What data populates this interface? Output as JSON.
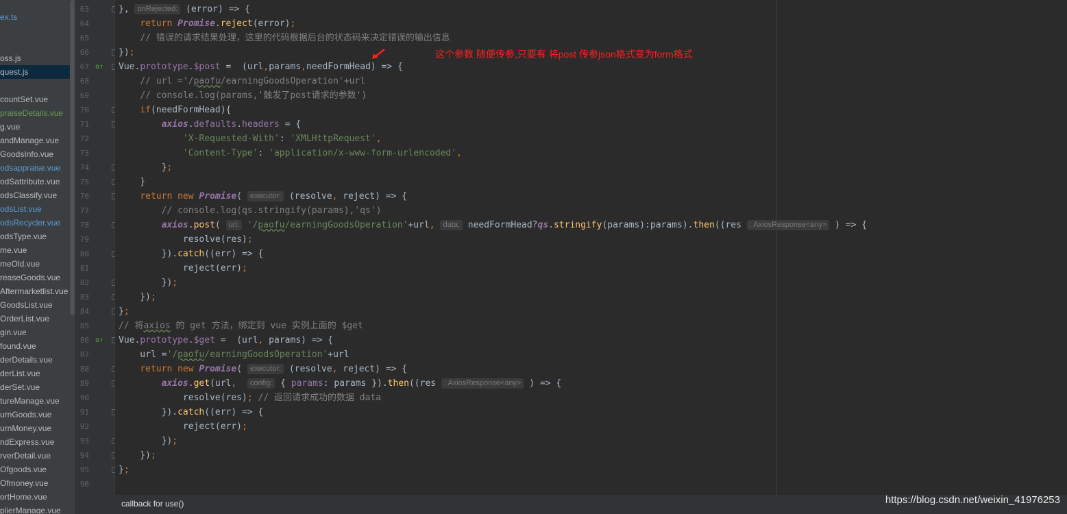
{
  "sidebar": {
    "items": [
      {
        "label": "ex.ts",
        "color": "#5b9bd5"
      },
      {
        "label": "oss.js",
        "color": "#bbbbbb"
      },
      {
        "label": "quest.js",
        "color": "#bbbbbb",
        "selected": true
      },
      {
        "label": "countSet.vue",
        "color": "#bbbbbb"
      },
      {
        "label": "praiseDetails.vue",
        "color": "#6a9955"
      },
      {
        "label": "g.vue",
        "color": "#bbbbbb"
      },
      {
        "label": "andManage.vue",
        "color": "#bbbbbb"
      },
      {
        "label": "GoodsInfo.vue",
        "color": "#bbbbbb"
      },
      {
        "label": "odsappraise.vue",
        "color": "#5b9bd5"
      },
      {
        "label": "odSattribute.vue",
        "color": "#bbbbbb"
      },
      {
        "label": "odsClassify.vue",
        "color": "#bbbbbb"
      },
      {
        "label": "odsList.vue",
        "color": "#5b9bd5"
      },
      {
        "label": "odsRecycler.vue",
        "color": "#5b9bd5"
      },
      {
        "label": "odsType.vue",
        "color": "#bbbbbb"
      },
      {
        "label": "me.vue",
        "color": "#bbbbbb"
      },
      {
        "label": "meOld.vue",
        "color": "#bbbbbb"
      },
      {
        "label": "reaseGoods.vue",
        "color": "#bbbbbb"
      },
      {
        "label": "Aftermarketlist.vue",
        "color": "#bbbbbb"
      },
      {
        "label": "GoodsList.vue",
        "color": "#bbbbbb"
      },
      {
        "label": "OrderList.vue",
        "color": "#bbbbbb"
      },
      {
        "label": "gin.vue",
        "color": "#bbbbbb"
      },
      {
        "label": "found.vue",
        "color": "#bbbbbb"
      },
      {
        "label": "derDetails.vue",
        "color": "#bbbbbb"
      },
      {
        "label": "derList.vue",
        "color": "#bbbbbb"
      },
      {
        "label": "derSet.vue",
        "color": "#bbbbbb"
      },
      {
        "label": "tureManage.vue",
        "color": "#bbbbbb"
      },
      {
        "label": "urnGoods.vue",
        "color": "#bbbbbb"
      },
      {
        "label": "urnMoney.vue",
        "color": "#bbbbbb"
      },
      {
        "label": "ndExpress.vue",
        "color": "#bbbbbb"
      },
      {
        "label": "rverDetail.vue",
        "color": "#bbbbbb"
      },
      {
        "label": "Ofgoods.vue",
        "color": "#bbbbbb"
      },
      {
        "label": "Ofmoney.vue",
        "color": "#bbbbbb"
      },
      {
        "label": "ortHome.vue",
        "color": "#bbbbbb"
      },
      {
        "label": "plierManage.vue",
        "color": "#bbbbbb"
      }
    ]
  },
  "editor": {
    "line_numbers": [
      "63",
      "64",
      "65",
      "66",
      "67",
      "68",
      "69",
      "70",
      "71",
      "72",
      "73",
      "74",
      "75",
      "76",
      "77",
      "78",
      "79",
      "80",
      "81",
      "82",
      "83",
      "84",
      "85",
      "86",
      "87",
      "88",
      "89",
      "90",
      "91",
      "92",
      "93",
      "94",
      "95",
      "96"
    ],
    "hints": {
      "on_rejected": "onRejected:",
      "executor": "executor:",
      "url": "url:",
      "data": "data:",
      "axios_response": ": AxiosResponse<any>",
      "config": "config:"
    },
    "strings": {
      "path_prefix": "'/",
      "paofu": "paofu",
      "path_rest": "/earningGoodsOperation'",
      "x_requested_key": "'X-Requested-With'",
      "x_requested_val": "'XMLHttpRequest'",
      "content_type_key": "'Content-Type'",
      "content_type_val": "'application/x-www-form-urlencoded'"
    },
    "comments": {
      "line65": "// 错误的请求结果处理，这里的代码根据后台的状态码来决定错误的输出信息",
      "line68_a": "// url ='/",
      "line68_b": "/earningGoodsOperation'+url",
      "line69": "// console.log(params,'触发了post请求的参数')",
      "line77": "// console.log(qs.stringify(params),'qs')",
      "line85_a": "// 将",
      "line85_axios": "axios",
      "line85_b": " 的 get 方法，绑定到 vue 实例上面的 $get",
      "line90": "// 返回请求成功的数据 data"
    }
  },
  "annotation": "这个参数 随便传参,只要有  将post 传参json格式变为form格式",
  "status": {
    "text": "callback for use()",
    "watermark": "https://blog.csdn.net/weixin_41976253"
  },
  "colors": {
    "background": "#2b2b2b",
    "keyword": "#cc7832",
    "string": "#6a8759",
    "function": "#ffc66d",
    "comment": "#808080",
    "annotation": "#ff1f1f"
  }
}
